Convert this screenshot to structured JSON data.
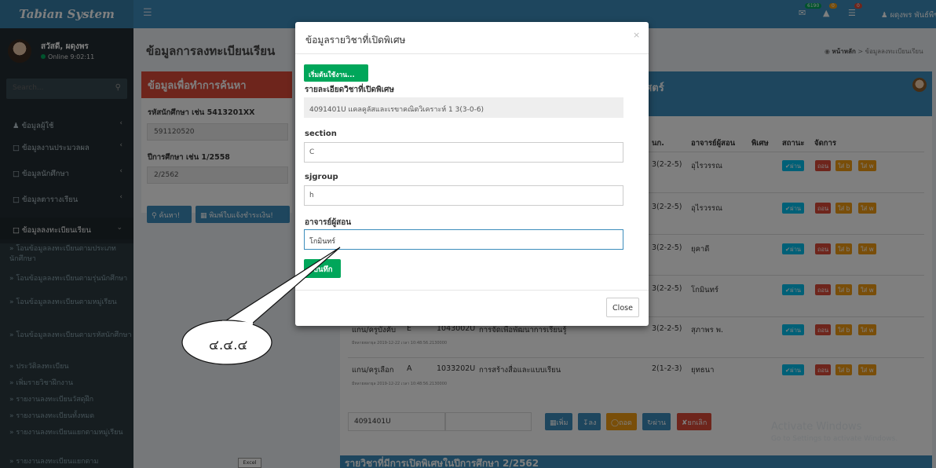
{
  "app": {
    "title": "Tabian System"
  },
  "user": {
    "name": "สวัสดี, ผดุงพร",
    "status": "Online 9:02:11"
  },
  "sidebar": {
    "search_placeholder": "Search...",
    "items": [
      {
        "label": "ข้อมูลผู้ใช้"
      },
      {
        "label": "ข้อมูลงานประมวลผล"
      },
      {
        "label": "ข้อมูลนักศึกษา"
      },
      {
        "label": "ข้อมูลตารางเรียน"
      },
      {
        "label": "ข้อมูลลงทะเบียนเรียน"
      }
    ],
    "subitems": [
      "» โอนข้อมูลลงทะเบียนตามประเภทนักศึกษา",
      "» โอนข้อมูลลงทะเบียนตามรุ่นนักศึกษา",
      "» โอนข้อมูลลงทะเบียนตามหมู่เรียน",
      "» โอนข้อมูลลงทะเบียนตามรหัสนักศึกษา",
      "» ประวัติลงทะเบียน",
      "» เพิ่มรายวิชาฝึกงาน",
      "» รายงานลงทะเบียนวัสดุฝึก",
      "» รายงานลงทะเบียนทั้งหมด",
      "» รายงานลงทะเบียนแยกตามหมู่เรียน",
      "» รายงานลงทะเบียนแยกตาม"
    ]
  },
  "topbar": {
    "mail_badge": "6190",
    "bell_badge": "0",
    "tasks_badge": "0",
    "user_label": "ผดุงพร พันธ์พืช"
  },
  "page": {
    "title": "ข้อมูลการลงทะเบียนเรียน",
    "breadcrumb_home": "หน้าหลัก",
    "breadcrumb_sep": ">",
    "breadcrumb_current": "ข้อมูลลงทะเบียนเรียน"
  },
  "search_panel": {
    "header": "ข้อมูลเพื่อทำการค้นหา",
    "student_label": "รหัสนักศึกษา เช่น 5413201XX",
    "student_value": "591120520",
    "year_label": "ปีการศึกษา เช่น 1/2558",
    "year_value": "2/2562",
    "search_btn": "ค้นหา!",
    "print_btn": "พิมพ์ใบแจ้งชำระเงิน!"
  },
  "main_panel": {
    "header_fragment": "ศตร์",
    "columns": [
      "นก.",
      "อาจารย์ผู้สอน",
      "พิเศษ",
      "สถานะ",
      "จัดการ"
    ],
    "rows": [
      {
        "credit": "3(2-2-5)",
        "teacher": "อุไรวรรณ",
        "status": "ผ่าน"
      },
      {
        "credit": "3(2-2-5)",
        "teacher": "อุไรวรรณ",
        "status": "ผ่าน"
      },
      {
        "credit": "3(2-2-5)",
        "teacher": "ยุคาดี",
        "status": "ผ่าน"
      },
      {
        "credit": "3(2-2-5)",
        "teacher": "โกมินทร์",
        "status": "ผ่าน"
      },
      {
        "type": "แกน/ครูบังคับ",
        "section": "E",
        "code": "1043002U",
        "name": "การจัดเพื่อพัฒนาการเรียนรู้",
        "credit": "3(2-2-5)",
        "teacher": "สุภาพร พ.",
        "status": "ผ่าน",
        "note": "มีหลายพลายุล 2019-12-22 เวลา 10:48:56.2130000"
      },
      {
        "type": "แกน/ครูเลือก",
        "section": "A",
        "code": "1033202U",
        "name": "การสร้างสื่อและแบบเรียน",
        "credit": "2(1-2-3)",
        "teacher": "ยุทธนา",
        "status": "ผ่าน",
        "note": "มีหลายพลายุล 2019-12-22 เวลา 10:48:56.2130000"
      }
    ],
    "actions": [
      "ถอน",
      "ใส่ b",
      "ใส่ w"
    ],
    "bottom_input": "4091401U",
    "bottom_buttons": [
      "เพิ่ม",
      "ลง",
      "ถอด",
      "ผ่าน",
      "ยกเลิก"
    ],
    "footer_title": "รายวิชาที่มีการเปิดพิเศษในปีการศึกษา 2/2562"
  },
  "watermark": {
    "line1": "Activate Windows",
    "line2": "Go to Settings to activate Windows."
  },
  "excel_label": "Excel",
  "modal": {
    "title": "ข้อมูลรายวิชาที่เปิดพิเศษ",
    "close_x": "×",
    "start_btn": "เริ่มต้นใช้งาน...",
    "detail_label": "รายละเอียดวิชาที่เปิดพิเศษ",
    "detail_value": "4091401U แคลคูลัสและเรขาคณิตวิเคราะห์ 1 3(3-0-6)",
    "section_label": "section",
    "section_value": "C",
    "sjgroup_label": "sjgroup",
    "sjgroup_value": "h",
    "teacher_label": "อาจารย์ผู้สอน",
    "teacher_value": "โกมินทร์",
    "save_btn": "บันทึก",
    "close_btn": "Close"
  },
  "annotation": {
    "callout": "๔.๔.๔"
  },
  "colors": {
    "primary": "#3c8dbc",
    "danger": "#dd4b39",
    "success": "#00a65a",
    "info": "#00c0ef",
    "warning": "#f39c12"
  }
}
